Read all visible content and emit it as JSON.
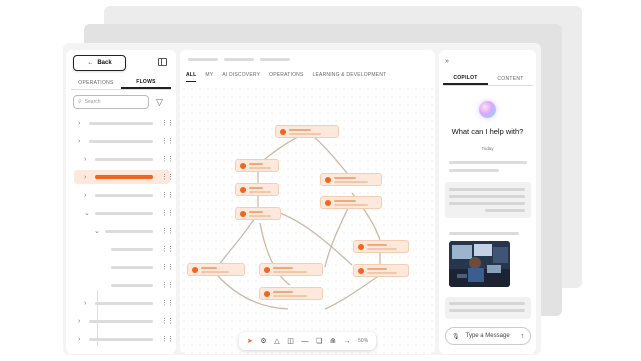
{
  "left": {
    "back_label": "Back",
    "tabs": [
      {
        "label": "OPERATIONS"
      },
      {
        "label": "FLOWS"
      }
    ],
    "search_placeholder": "Search"
  },
  "center": {
    "tabs": [
      {
        "label": "ALL"
      },
      {
        "label": "MY"
      },
      {
        "label": "AI DISCOVERY"
      },
      {
        "label": "OPERATIONS"
      },
      {
        "label": "LEARNING & DEVELOPMENT"
      }
    ],
    "zoom": "50%"
  },
  "right": {
    "tabs": [
      {
        "label": "COPILOT"
      },
      {
        "label": "CONTENT"
      }
    ],
    "prompt": "What can I help with?",
    "date_divider": "Today",
    "input_placeholder": "Type a Message"
  },
  "colors": {
    "accent": "#f06522",
    "node_fill": "#fde9dc",
    "edge": "#cdb8a6"
  },
  "icons": [
    "arrow-left-icon",
    "sidebar-toggle-icon",
    "search-icon",
    "filter-icon",
    "chevron-right-icon",
    "chevron-down-icon",
    "drag-handle-icon",
    "collapse-panel-icon",
    "pointer-icon",
    "settings-icon",
    "stack-icon",
    "document-icon",
    "minus-icon",
    "copy-icon",
    "connect-icon",
    "arrow-right-icon",
    "microphone-icon",
    "send-icon"
  ]
}
